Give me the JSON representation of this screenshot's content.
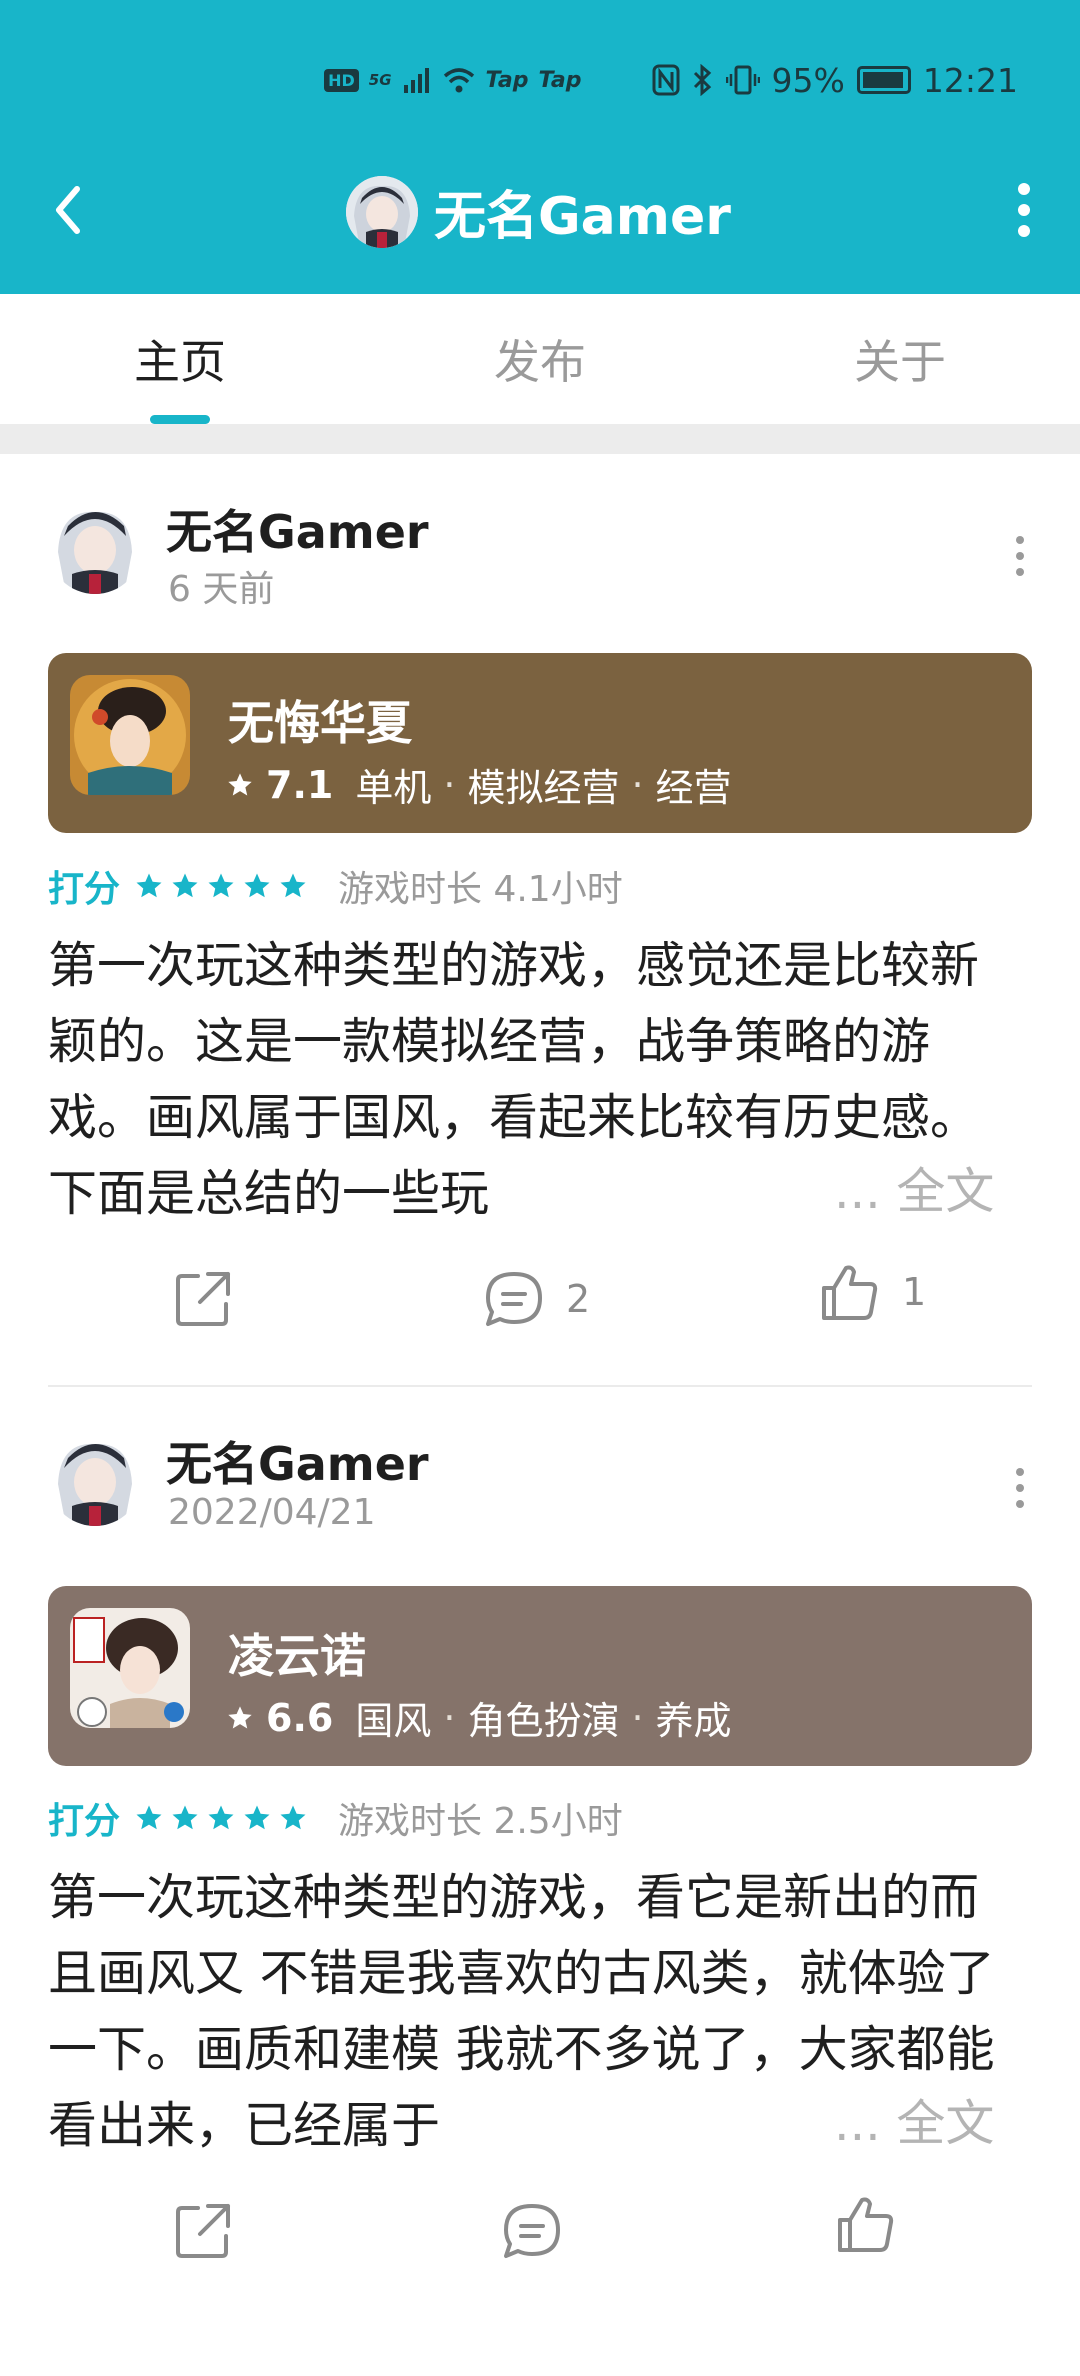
{
  "status_bar": {
    "network": "5G",
    "hd": "HD",
    "tap1": "Tap",
    "tap2": "Tap",
    "battery": "95%",
    "time": "12:21"
  },
  "nav": {
    "title": "无名Gamer"
  },
  "tabs": [
    {
      "label": "主页",
      "active": true
    },
    {
      "label": "发布",
      "active": false
    },
    {
      "label": "关于",
      "active": false
    }
  ],
  "rate_label": "打分",
  "ellipsis": "...",
  "full_text_label": "全文",
  "posts": [
    {
      "author": "无名Gamer",
      "time": "6 天前",
      "game": {
        "name": "无悔华夏",
        "score": "7.1",
        "tags": [
          "单机",
          "模拟经营",
          "经营"
        ],
        "card_color": "#7b6240"
      },
      "rating_stars": 5,
      "playtime": "游戏时长 4.1小时",
      "text": "第一次玩这种类型的游戏，感觉还是比较新颖的。这是一款模拟经营，战争策略的游戏。画风属于国风，看起来比较有历史感。下面是总结的一些玩",
      "comments": "2",
      "likes": "1"
    },
    {
      "author": "无名Gamer",
      "time": "2022/04/21",
      "game": {
        "name": "凌云诺",
        "score": "6.6",
        "tags": [
          "国风",
          "角色扮演",
          "养成"
        ],
        "card_color": "#85736a"
      },
      "rating_stars": 5,
      "playtime": "游戏时长 2.5小时",
      "text": "第一次玩这种类型的游戏，看它是新出的而且画风又 不错是我喜欢的古风类，就体验了一下。画质和建模 我就不多说了，大家都能看出来，已经属于",
      "comments": "",
      "likes": ""
    }
  ],
  "colors": {
    "header": "#18b5c9",
    "accent": "#18b5c9"
  }
}
